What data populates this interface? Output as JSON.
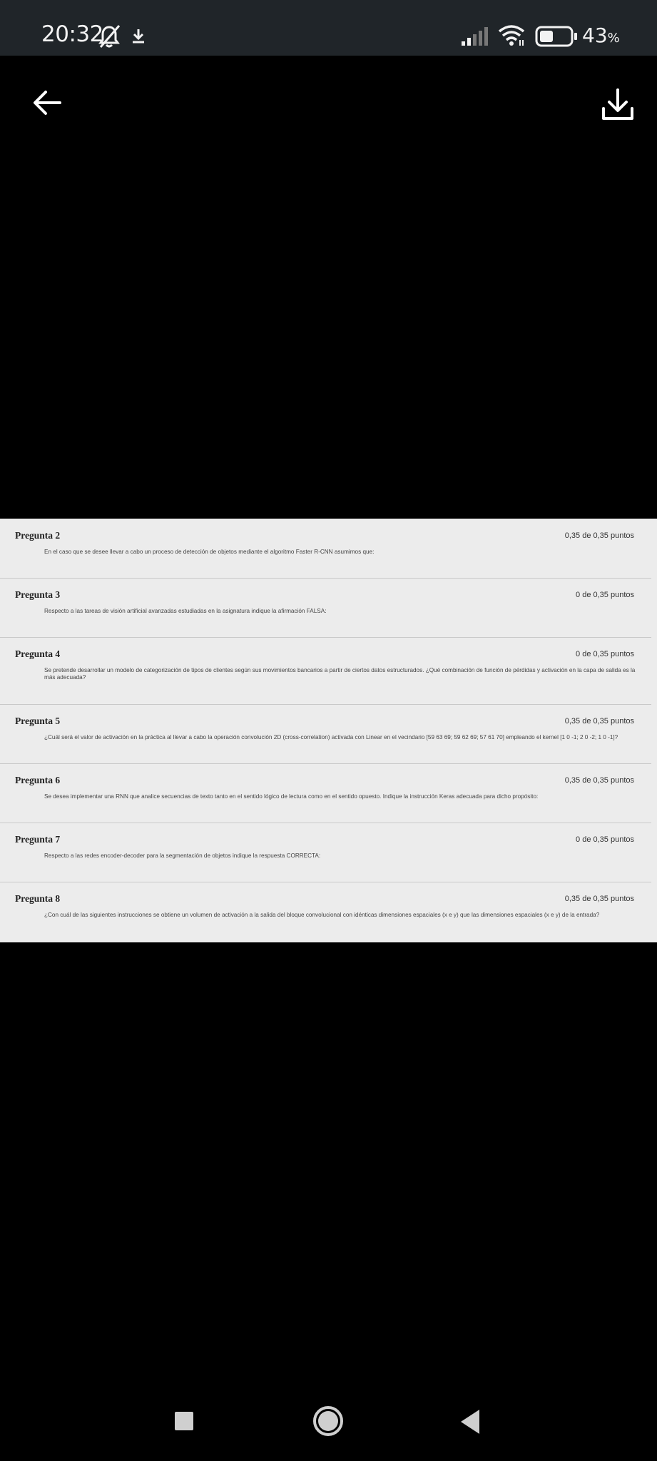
{
  "status_bar": {
    "time": "20:32",
    "battery_percent": "43",
    "battery_symbol": "%",
    "icons": [
      "bell-off-icon",
      "download-icon",
      "signal-icon",
      "wifi-icon",
      "battery-icon"
    ]
  },
  "toolbar": {
    "back_icon": "arrow-left-icon",
    "download_icon": "download-icon"
  },
  "questions": [
    {
      "title": "Pregunta 2",
      "score": "0,35 de 0,35 puntos",
      "text": "En el caso que se desee llevar a cabo un proceso de detección de objetos mediante el algoritmo Faster R-CNN asumimos que:"
    },
    {
      "title": "Pregunta 3",
      "score": "0 de 0,35 puntos",
      "text": "Respecto a las tareas de visión artificial avanzadas estudiadas en la asignatura indique la afirmación FALSA:"
    },
    {
      "title": "Pregunta 4",
      "score": "0 de 0,35 puntos",
      "text": "Se pretende desarrollar un modelo de categorización de tipos de clientes según sus movimientos bancarios a partir de ciertos datos estructurados. ¿Qué combinación de función de pérdidas y activación en la capa de salida es la más adecuada?"
    },
    {
      "title": "Pregunta 5",
      "score": "0,35 de 0,35 puntos",
      "text": "¿Cuál será el valor de activación en la práctica al llevar a cabo la operación convolución 2D (cross-correlation) activada con Linear en el vecindario [59 63 69; 59 62 69; 57 61 70] empleando el kernel [1 0 -1; 2 0 -2; 1 0 -1]?"
    },
    {
      "title": "Pregunta 6",
      "score": "0,35 de 0,35 puntos",
      "text": "Se desea implementar una RNN que analice secuencias de texto tanto en el sentido lógico de lectura como en el sentido opuesto. Indique la instrucción Keras adecuada para dicho propósito:"
    },
    {
      "title": "Pregunta 7",
      "score": "0 de 0,35 puntos",
      "text": "Respecto a las redes encoder-decoder para la segmentación de objetos indique la respuesta CORRECTA:"
    },
    {
      "title": "Pregunta 8",
      "score": "0,35 de 0,35 puntos",
      "text": "¿Con cuál de las siguientes instrucciones se obtiene un volumen de activación a la salida del bloque convolucional con idénticas dimensiones espaciales (x e y) que las dimensiones espaciales (x e y) de la entrada?"
    }
  ],
  "nav_bar": {
    "icons": [
      "recents-square-icon",
      "home-circle-icon",
      "back-triangle-icon"
    ]
  }
}
